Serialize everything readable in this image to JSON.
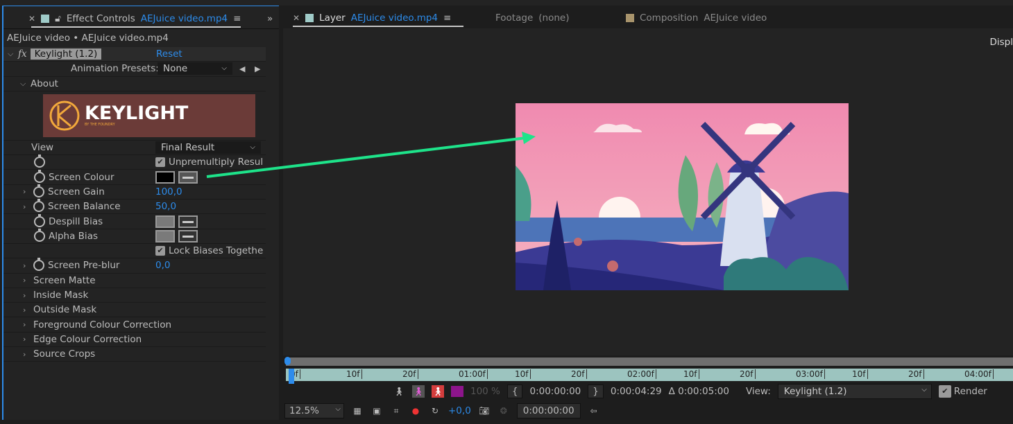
{
  "effect_panel": {
    "tab": {
      "title": "Effect Controls",
      "file": "AEJuice video.mp4"
    },
    "breadcrumb": "AEJuice video • AEJuice video.mp4",
    "effect": {
      "name": "Keylight (1.2)",
      "reset": "Reset"
    },
    "presets": {
      "label": "Animation Presets:",
      "value": "None"
    },
    "about": "About",
    "logo_text": "KEYLIGHT",
    "logo_sub": "BY THE FOUNDRY",
    "view": {
      "label": "View",
      "value": "Final Result"
    },
    "unpremultiply": "Unpremultiply Resul",
    "screen_colour": {
      "label": "Screen Colour",
      "color": "#000000"
    },
    "screen_gain": {
      "label": "Screen Gain",
      "value": "100,0"
    },
    "screen_balance": {
      "label": "Screen Balance",
      "value": "50,0"
    },
    "despill_bias": "Despill Bias",
    "alpha_bias": "Alpha Bias",
    "lock_biases": "Lock Biases Togethe",
    "screen_preblur": {
      "label": "Screen Pre-blur",
      "value": "0,0"
    },
    "groups": [
      "Screen Matte",
      "Inside Mask",
      "Outside Mask",
      "Foreground Colour Correction",
      "Edge Colour Correction",
      "Source Crops"
    ]
  },
  "layer_panel": {
    "tab_layer": {
      "title": "Layer",
      "file": "AEJuice video.mp4"
    },
    "tab_footage": {
      "title": "Footage",
      "value": "(none)"
    },
    "tab_comp": {
      "title": "Composition",
      "value": "AEJuice video"
    },
    "display_cut": "Displ",
    "ruler": [
      "0f",
      "10f",
      "20f",
      "01:00f",
      "10f",
      "20f",
      "02:00f",
      "10f",
      "20f",
      "03:00f",
      "10f",
      "20f",
      "04:00f"
    ],
    "opacity": "100 %",
    "in_time": "0:00:00:00",
    "out_time": "0:00:04:29",
    "duration": "Δ 0:00:05:00",
    "view_label": "View:",
    "view_value": "Keylight (1.2)",
    "render": "Render",
    "zoom": "12.5%",
    "exposure": "+0,0",
    "current_time": "0:00:00:00"
  },
  "colors": {
    "accent": "#2d8ceb",
    "arrow": "#1ee38a",
    "ruler": "#9cc4bf"
  }
}
